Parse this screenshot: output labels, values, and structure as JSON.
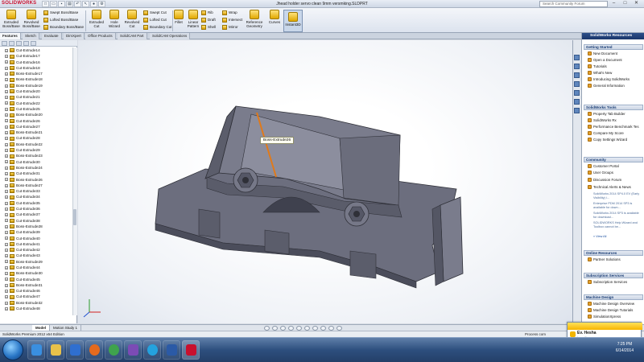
{
  "app": {
    "logo": "SOLIDWORKS",
    "doc_title": "Jhead holder servo clean 9mm versmking.SLDPRT",
    "search_placeholder": "Search Community Forum",
    "win_min": "–",
    "win_max": "□",
    "win_close": "✕"
  },
  "ribbon": {
    "extruded_boss": "Extruded Boss/Base",
    "revolved_boss": "Revolved Boss/Base",
    "swept_boss": "Swept Boss/Base",
    "lofted_boss": "Lofted Boss/Base",
    "boundary_boss": "Boundary Boss/Base",
    "extruded_cut": "Extruded Cut",
    "hole_wizard": "Hole Wizard",
    "revolved_cut": "Revolved Cut",
    "swept_cut": "Swept Cut",
    "lofted_cut": "Lofted Cut",
    "boundary_cut": "Boundary Cut",
    "fillet": "Fillet",
    "linear_pattern": "Linear Pattern",
    "rib": "Rib",
    "draft": "Draft",
    "shell": "Shell",
    "wrap": "Wrap",
    "intersect": "Intersect",
    "mirror": "Mirror",
    "reference_geometry": "Reference Geometry",
    "curves": "Curves",
    "instant3d": "Instant3D"
  },
  "tabs": [
    "Features",
    "Sketch",
    "Evaluate",
    "DimXpert",
    "Office Products",
    "SolidCAM Part",
    "SolidCAM Operations"
  ],
  "feature_tree": [
    "Cut-Extrude14",
    "Cut-Extrude17",
    "Cut-Extrude16",
    "Cut-Extrude18",
    "Boss-Extrude17",
    "Boss-Extrude18",
    "Boss-Extrude19",
    "Cut-Extrude20",
    "Cut-Extrude21",
    "Cut-Extrude22",
    "Cut-Extrude25",
    "Boss-Extrude20",
    "Cut-Extrude26",
    "Cut-Extrude27",
    "Boss-Extrude21",
    "Cut-Extrude28",
    "Boss-Extrude22",
    "Cut-Extrude29",
    "Boss-Extrude23",
    "Cut-Extrude30",
    "Boss-Extrude24",
    "Cut-Extrude31",
    "Boss-Extrude26",
    "Boss-Extrude27",
    "Cut-Extrude33",
    "Cut-Extrude34",
    "Cut-Extrude35",
    "Cut-Extrude36",
    "Cut-Extrude37",
    "Cut-Extrude38",
    "Boss-Extrude28",
    "Cut-Extrude39",
    "Cut-Extrude40",
    "Cut-Extrude41",
    "Cut-Extrude42",
    "Cut-Extrude43",
    "Boss-Extrude29",
    "Cut-Extrude44",
    "Boss-Extrude30",
    "Cut-Extrude45",
    "Boss-Extrude31",
    "Cut-Extrude46",
    "Cut-Extrude47",
    "Boss-Extrude32",
    "Cut-Extrude48"
  ],
  "viewport": {
    "tooltip": "Boss-Extrude26",
    "part_color": "#6c6e7e",
    "part_dark": "#4b4d5b",
    "part_light": "#8c8e9e"
  },
  "model_tabs": [
    "Model",
    "Motion Study 1"
  ],
  "status": {
    "left": "SolidWorks Premium 2012 x64 Edition",
    "right": "Process com"
  },
  "taskpane": {
    "header": "SolidWorks Resources",
    "getting_started": "Getting Started",
    "gs_links": [
      "New Document",
      "Open a Document",
      "Tutorials",
      "What's New",
      "Introducing SolidWorks",
      "General Information"
    ],
    "tools": "SolidWorks Tools",
    "tools_links": [
      "Property Tab Builder",
      "SolidWorks Rx",
      "Performance Benchmark Tes",
      "Compare My Score",
      "Copy Settings Wizard"
    ],
    "community": "Community",
    "community_links": [
      "Customer Portal",
      "User Groups",
      "Discussion Forum",
      "Technical Alerts & News"
    ],
    "news": [
      "SolidWorks 2014 SP4.0 EV (Early Visibility) i...",
      "Enterprise PDM 2014 SP3 is available for down...",
      "SolidWorks 2014 SP3 is available for download...",
      "SOLIDWORKS Help Wizard and Toolbox cannot be..."
    ],
    "view_all": "» View All",
    "online": "Online Resources",
    "online_links": [
      "Partner Solutions"
    ],
    "subscription": "Subscription Services",
    "subscription_links": [
      "Subscription Services"
    ],
    "machine": "Machine Design",
    "machine_links": [
      "Machine Design Overview",
      "Machine Design Tutorials",
      "SimulationXpress"
    ]
  },
  "notification": {
    "title": "Ev. Hesha",
    "subtitle": "is online"
  },
  "clock": {
    "time": "7:25 PM",
    "date": "6/14/2014"
  }
}
